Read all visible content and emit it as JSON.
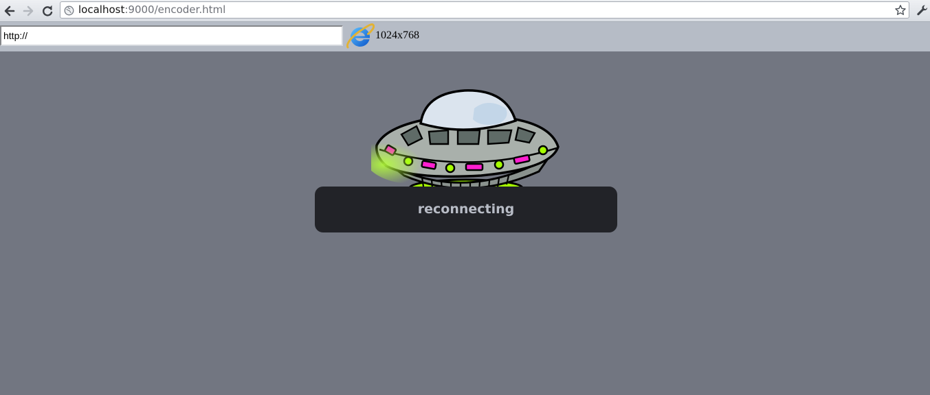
{
  "browser": {
    "address": {
      "host": "localhost",
      "rest": ":9000/encoder.html"
    }
  },
  "toolbar": {
    "url_input_value": "http://",
    "resolution": "1024x768"
  },
  "status": {
    "text": "reconnecting"
  },
  "icons": {
    "back": "back-arrow-icon",
    "forward": "forward-arrow-icon",
    "reload": "reload-icon",
    "page": "globe-icon",
    "bookmark": "star-icon",
    "settings": "wrench-icon",
    "browser_logo": "internet-explorer-logo",
    "illustration": "ufo-spaceship"
  },
  "colors": {
    "page_background": "#727681",
    "toolbar_background": "#b6bcc6",
    "status_box": "#222328",
    "status_text": "#b8bcc6",
    "ufo_lights_green": "#a6ff00",
    "ufo_lights_pink": "#ff1fd0"
  }
}
